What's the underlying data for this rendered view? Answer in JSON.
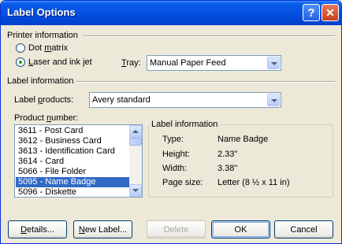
{
  "window": {
    "title": "Label Options"
  },
  "titlebar_buttons": {
    "help": "?",
    "close": "✕"
  },
  "printer": {
    "section_title": "Printer information",
    "dot_matrix": {
      "before": "Dot ",
      "accel": "m",
      "after": "atrix",
      "checked": false
    },
    "laser": {
      "before": "",
      "accel": "L",
      "after": "aser and ink jet",
      "checked": true
    },
    "tray_label": {
      "before": "",
      "accel": "T",
      "after": "ray:"
    },
    "tray_value": "Manual Paper Feed"
  },
  "label_info": {
    "section_title": "Label information",
    "products_label": {
      "before": "Label ",
      "accel": "p",
      "after": "roducts:"
    },
    "products_value": "Avery standard",
    "product_number_label": {
      "before": "Product ",
      "accel": "n",
      "after": "umber:"
    },
    "product_items": [
      "3611 - Post Card",
      "3612 - Business Card",
      "3613 - Identification Card",
      "3614 - Card",
      "5066 - File Folder",
      "5095 - Name Badge",
      "5096 - Diskette"
    ],
    "selected_item": "5095 - Name Badge"
  },
  "details": {
    "group_title": "Label information",
    "rows": [
      {
        "label": "Type:",
        "value": "Name Badge"
      },
      {
        "label": "Height:",
        "value": "2.33\""
      },
      {
        "label": "Width:",
        "value": "3.38\""
      },
      {
        "label": "Page size:",
        "value": "Letter (8 ½ x 11 in)"
      }
    ]
  },
  "buttons": {
    "details": {
      "before": "",
      "accel": "D",
      "after": "etails..."
    },
    "new_label": {
      "before": "",
      "accel": "N",
      "after": "ew Label..."
    },
    "delete": "Delete",
    "ok": "OK",
    "cancel": "Cancel"
  },
  "icons": {
    "combo_arrow": "chevron-down-icon",
    "scroll_up": "arrow-up-icon",
    "scroll_down": "arrow-down-icon"
  }
}
